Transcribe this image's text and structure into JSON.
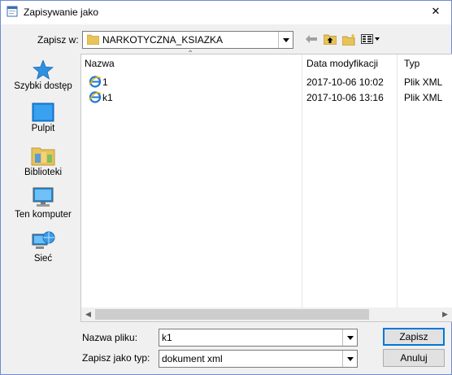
{
  "window": {
    "title": "Zapisywanie jako",
    "close_symbol": "✕"
  },
  "toolbar": {
    "save_in_label": "Zapisz w:",
    "save_in_value": "NARKOTYCZNA_KSIAZKA",
    "icons": [
      "back-arrow-icon",
      "up-folder-icon",
      "new-folder-icon",
      "view-menu-icon"
    ]
  },
  "places": [
    {
      "label": "Szybki dostęp",
      "icon": "quick-access-star-icon"
    },
    {
      "label": "Pulpit",
      "icon": "desktop-icon"
    },
    {
      "label": "Biblioteki",
      "icon": "libraries-icon"
    },
    {
      "label": "Ten komputer",
      "icon": "computer-icon"
    },
    {
      "label": "Sieć",
      "icon": "network-icon"
    }
  ],
  "file_list": {
    "columns": [
      "Nazwa",
      "Data modyfikacji",
      "Typ"
    ],
    "rows": [
      {
        "name": "1",
        "date": "2017-10-06 10:02",
        "type": "Plik XML",
        "icon": "ie-xml-icon"
      },
      {
        "name": "k1",
        "date": "2017-10-06 13:16",
        "type": "Plik XML",
        "icon": "ie-xml-icon"
      }
    ]
  },
  "form": {
    "filename_label": "Nazwa pliku:",
    "filename_value": "k1",
    "filetype_label": "Zapisz jako typ:",
    "filetype_value": "dokument xml"
  },
  "buttons": {
    "save": "Zapisz",
    "cancel": "Anuluj"
  },
  "colors": {
    "accent": "#0078d7",
    "folder": "#e8c35a",
    "dialog_bg": "#f0f0f0"
  }
}
